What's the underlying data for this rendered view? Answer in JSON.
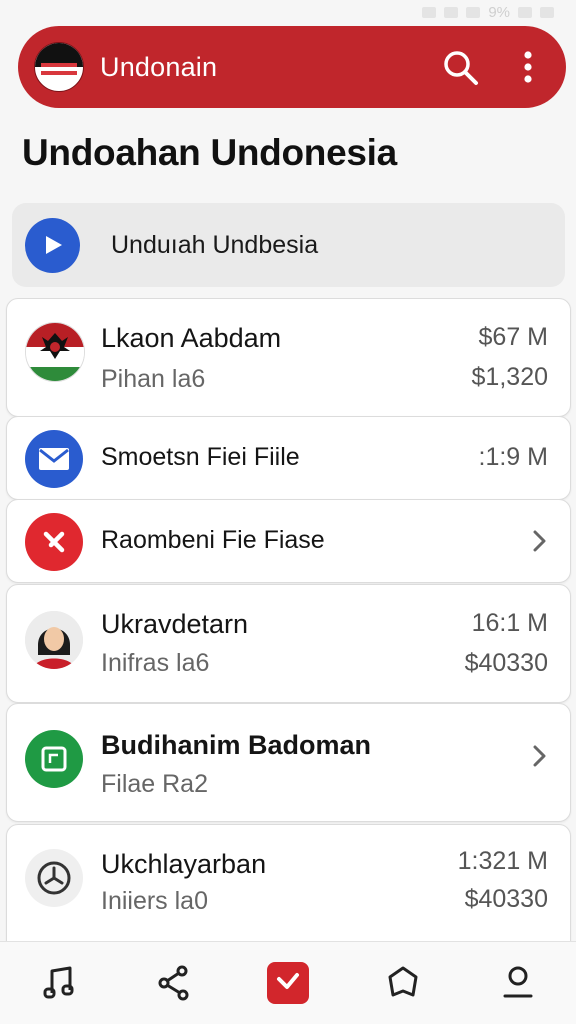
{
  "status_bar": {
    "battery_text": "9%"
  },
  "app_bar": {
    "title": "Undonain"
  },
  "page": {
    "title": "Undoahan Undonesia"
  },
  "banner": {
    "label": "Unduıah Undbesia"
  },
  "items": [
    {
      "title": "Lkaon Aabdam",
      "subtitle": "Pihan la6",
      "value_primary": "$67 M",
      "value_secondary": "$1,320",
      "icon": "flag-emblem-icon"
    },
    {
      "title": "Smoetsn Fiei Fiile",
      "value_primary": ":1:9 M",
      "icon": "mail-icon"
    },
    {
      "title": "Raombeni Fie Fiase",
      "icon": "reject-icon",
      "chevron": true
    },
    {
      "title": "Ukravdetarn",
      "subtitle": "Inifras la6",
      "value_primary": "16:1 M",
      "value_secondary": "$40330",
      "icon": "person-avatar"
    },
    {
      "title": "Budihanim Badoman",
      "subtitle": "Filae Ra2",
      "icon": "document-icon",
      "chevron": true
    },
    {
      "title": "Ukchlayarban",
      "subtitle": "Iniiers la0",
      "value_primary": "1:321 M",
      "value_secondary": "$40330",
      "icon": "clock-icon"
    }
  ],
  "bottom_nav": [
    {
      "icon": "music-icon"
    },
    {
      "icon": "share-icon"
    },
    {
      "icon": "flag-icon",
      "active": true
    },
    {
      "icon": "shield-icon"
    },
    {
      "icon": "profile-icon"
    }
  ],
  "colors": {
    "brand_red": "#c0262c",
    "accent_blue": "#2a5ccf",
    "accent_green": "#1f9a44"
  }
}
